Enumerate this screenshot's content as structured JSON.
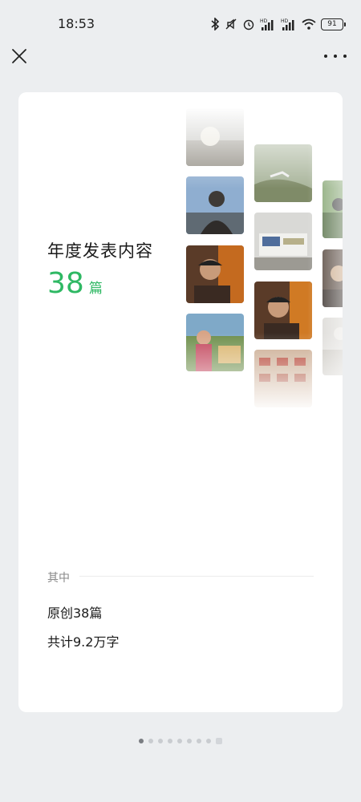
{
  "status_bar": {
    "time": "18:53",
    "battery": "91",
    "icons": [
      "bluetooth-icon",
      "mute-icon",
      "alarm-icon",
      "hd-signal-icon",
      "hd-signal-icon",
      "wifi-icon",
      "battery-icon"
    ]
  },
  "nav": {
    "close_icon": "close-icon",
    "more_icon": "more-icon"
  },
  "card": {
    "title": "年度发表内容",
    "count": "38",
    "count_unit": "篇",
    "section_label": "其中",
    "stat_original": "原创38篇",
    "stat_words": "共计9.2万字"
  },
  "pager": {
    "total_dots": 9,
    "active_index": 0
  },
  "colors": {
    "accent": "#2eb863",
    "background": "#eceef0",
    "card": "#ffffff"
  }
}
